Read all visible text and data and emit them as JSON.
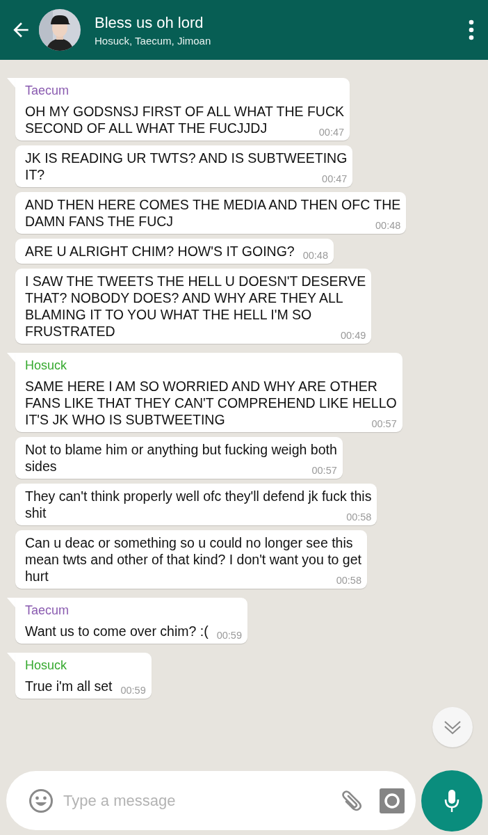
{
  "header": {
    "title": "Bless us oh lord",
    "subtitle": "Hosuck, Taecum, Jimoan"
  },
  "messages": [
    {
      "sender": "Taecum",
      "color": "#8a5bb0",
      "text": "OH MY GODSNSJ FIRST OF ALL WHAT THE FUCK\nSECOND OF ALL WHAT THE FUCJJDJ",
      "time": "00:47"
    },
    {
      "text": "JK IS READING UR TWTS? AND IS SUBTWEETING\nIT?",
      "time": "00:47"
    },
    {
      "text": "AND THEN HERE COMES THE MEDIA AND THEN OFC THE\nDAMN FANS THE FUCJ",
      "time": "00:48"
    },
    {
      "text": "ARE U ALRIGHT CHIM? HOW'S IT GOING?",
      "time": "00:48"
    },
    {
      "text": "I SAW THE TWEETS THE HELL U DOESN'T DESERVE\nTHAT? NOBODY DOES? AND WHY ARE THEY ALL\nBLAMING IT TO YOU WHAT THE HELL I'M SO\nFRUSTRATED",
      "time": "00:49"
    },
    {
      "sender": "Hosuck",
      "color": "#35a92e",
      "text": "SAME HERE I AM SO WORRIED AND WHY ARE OTHER\nFANS LIKE THAT THEY CAN'T COMPREHEND LIKE HELLO\nIT'S JK WHO IS SUBTWEETING",
      "time": "00:57"
    },
    {
      "text": "Not to blame him or anything but fucking weigh both\nsides",
      "time": "00:57"
    },
    {
      "text": "They can't think properly well ofc they'll defend jk fuck this\nshit",
      "time": "00:58"
    },
    {
      "text": "Can u deac or something so u could no longer see this\nmean twts and other of that kind? I don't want you to get\nhurt",
      "time": "00:58"
    },
    {
      "sender": "Taecum",
      "color": "#8a5bb0",
      "text": "Want us to come over chim? :(",
      "time": "00:59"
    },
    {
      "sender": "Hosuck",
      "color": "#35a92e",
      "text": "True i'm all set",
      "time": "00:59"
    }
  ],
  "composer": {
    "placeholder": "Type a message"
  }
}
